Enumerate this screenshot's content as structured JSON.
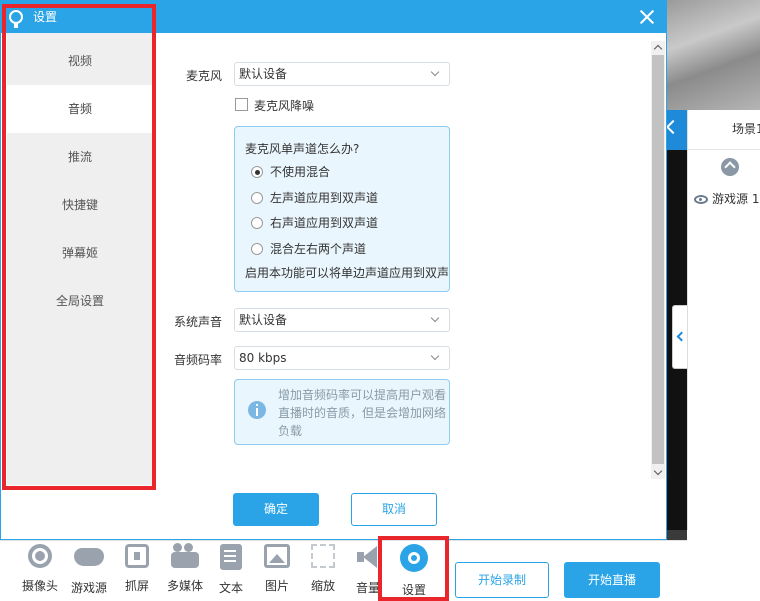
{
  "dialog": {
    "title": "设置",
    "nav": [
      "视频",
      "音频",
      "推流",
      "快捷键",
      "弹幕姬",
      "全局设置"
    ],
    "active_tab": "音频",
    "mic_label": "麦克风",
    "mic_value": "默认设备",
    "mic_noise_label": "麦克风降噪",
    "mono_box": {
      "question": "麦克风单声道怎么办?",
      "options": [
        "不使用混合",
        "左声道应用到双声道",
        "右声道应用到双声道",
        "混合左右两个声道"
      ],
      "selected": "不使用混合",
      "hint": "启用本功能可以将单边声道应用到双声道"
    },
    "system_sound_label": "系统声音",
    "system_sound_value": "默认设备",
    "bitrate_label": "音频码率",
    "bitrate_value": "80 kbps",
    "bitrate_info": "增加音频码率可以提高用户观看直播时的音质，但是会增加网络负载",
    "ok_label": "确定",
    "cancel_label": "取消"
  },
  "scene_panel": {
    "title": "场景1",
    "sources": [
      "游戏源 1"
    ]
  },
  "toolbar": {
    "items": [
      "摄像头",
      "游戏源",
      "抓屏",
      "多媒体",
      "文本",
      "图片",
      "缩放",
      "音量",
      "设置"
    ],
    "record_label": "开始录制",
    "live_label": "开始直播"
  },
  "colors": {
    "accent": "#2aa4e6",
    "highlight_box": "#e8262b",
    "nav_bg": "#efefef"
  }
}
